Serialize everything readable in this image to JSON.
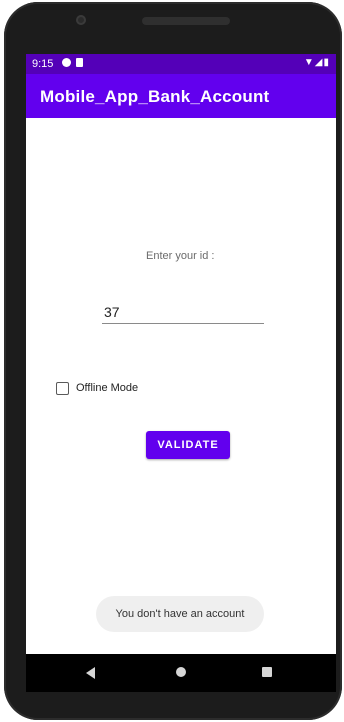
{
  "status_bar": {
    "time": "9:15",
    "right_icons": "▼◢▮"
  },
  "app_bar": {
    "title": "Mobile_App_Bank_Account"
  },
  "form": {
    "prompt": "Enter your id :",
    "id_value": "37",
    "offline_label": "Offline Mode",
    "offline_checked": false,
    "validate_label": "VALIDATE"
  },
  "toast": {
    "message": "You don't have an account"
  },
  "colors": {
    "primary": "#6200ee",
    "status_bar": "#5400b8"
  },
  "icons": {
    "back": "back-icon",
    "home": "home-icon",
    "recents": "recents-icon"
  }
}
